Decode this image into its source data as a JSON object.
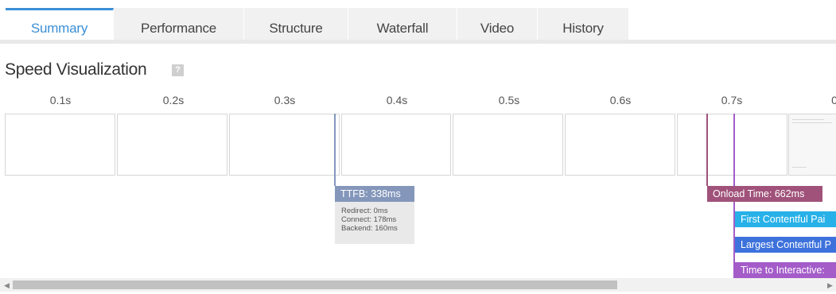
{
  "tabs": [
    {
      "label": "Summary",
      "active": true
    },
    {
      "label": "Performance",
      "active": false
    },
    {
      "label": "Structure",
      "active": false
    },
    {
      "label": "Waterfall",
      "active": false
    },
    {
      "label": "Video",
      "active": false
    },
    {
      "label": "History",
      "active": false
    }
  ],
  "section": {
    "title": "Speed Visualization",
    "help": "?"
  },
  "timeline": {
    "ticks": [
      "0.1s",
      "0.2s",
      "0.3s",
      "0.4s",
      "0.5s",
      "0.6s",
      "0.7s",
      "0"
    ]
  },
  "markers": {
    "ttfb": {
      "label": "TTFB: 338ms",
      "color": "#8497bb",
      "details": [
        "Redirect: 0ms",
        "Connect: 178ms",
        "Backend: 160ms"
      ]
    },
    "onload": {
      "label": "Onload Time: 662ms",
      "color": "#a0527a"
    },
    "fcp": {
      "label": "First Contentful Pai",
      "color": "#27b1e8"
    },
    "lcp": {
      "label": "Largest Contentful P",
      "color": "#3d72dc"
    },
    "tti": {
      "label": "Time to Interactive:",
      "color": "#a45cc9"
    }
  },
  "colors": {
    "accent": "#3b8fd6"
  }
}
